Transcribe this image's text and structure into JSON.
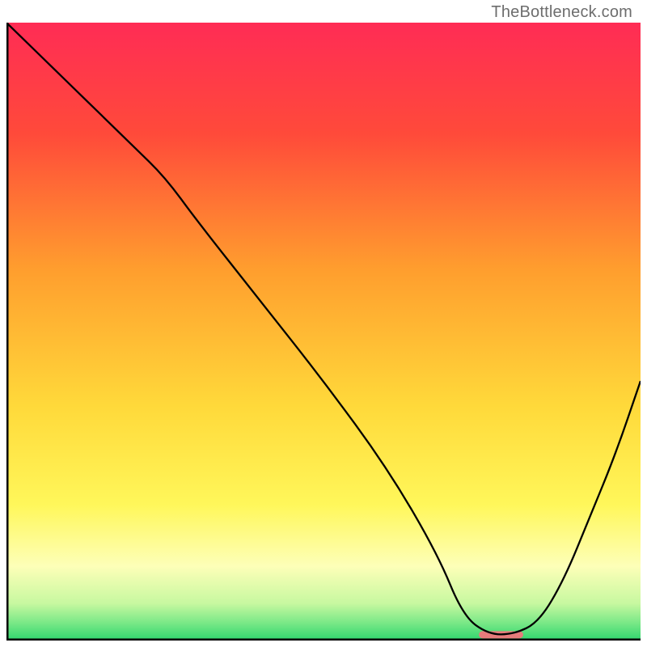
{
  "watermark": "TheBottleneck.com",
  "chart_data": {
    "type": "line",
    "title": "",
    "xlabel": "",
    "ylabel": "",
    "xlim": [
      0,
      100
    ],
    "ylim": [
      0,
      100
    ],
    "grid": false,
    "legend": false,
    "series": [
      {
        "name": "curve",
        "color": "#000000",
        "x": [
          0,
          10,
          20,
          25,
          30,
          40,
          50,
          60,
          68,
          72,
          76,
          80,
          84,
          88,
          92,
          96,
          100
        ],
        "values": [
          100,
          90,
          80,
          75,
          68,
          55,
          42,
          28,
          14,
          4,
          1,
          1,
          3,
          10,
          20,
          30,
          42
        ]
      }
    ],
    "marker": {
      "x_center": 78,
      "width": 7,
      "y": 1,
      "color": "#e67b7b"
    },
    "gradient_stops": [
      {
        "offset": 0.0,
        "color": "#ff2c55"
      },
      {
        "offset": 0.18,
        "color": "#ff4a3a"
      },
      {
        "offset": 0.4,
        "color": "#ff9e2e"
      },
      {
        "offset": 0.62,
        "color": "#ffd93a"
      },
      {
        "offset": 0.78,
        "color": "#fff75a"
      },
      {
        "offset": 0.88,
        "color": "#fdffb8"
      },
      {
        "offset": 0.94,
        "color": "#c7f8a0"
      },
      {
        "offset": 0.97,
        "color": "#7de988"
      },
      {
        "offset": 1.0,
        "color": "#2fd66e"
      }
    ],
    "axes_color": "#000000"
  }
}
